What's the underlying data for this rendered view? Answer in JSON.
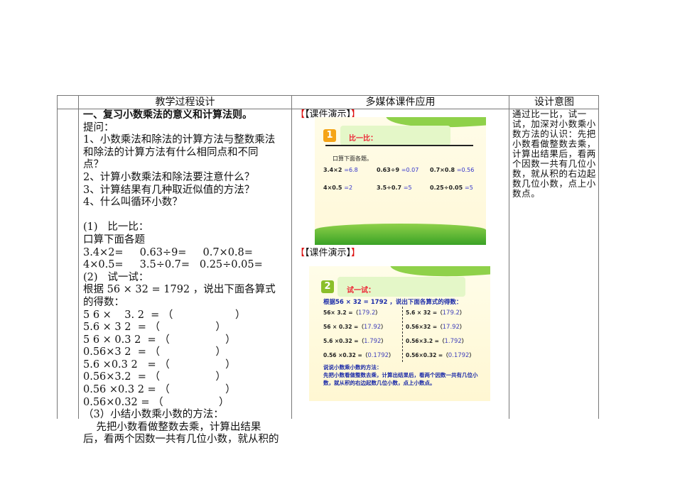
{
  "headers": [
    "教学过程设计",
    "多媒体课件应用",
    "设计意图"
  ],
  "left_lines": [
    {
      "t": "一、复习小数乘法的意义和计算法则。",
      "bold": true
    },
    {
      "t": "提问："
    },
    {
      "t": "1、小数乘法和除法的计算方法与整数乘法"
    },
    {
      "t": "和除法的计算方法有什么相同点和不同"
    },
    {
      "t": "点？"
    },
    {
      "t": "2、计算小数乘法和除法要注意什么？"
    },
    {
      "t": "3、计算结果有几种取近似值的方法？"
    },
    {
      "t": "4、什么叫循环小数？"
    },
    {
      "t": " "
    },
    {
      "t": "(1)   比一比："
    },
    {
      "t": "口算下面各题"
    },
    {
      "t": "3.4×2=     0.63÷9=     0.7×0.8="
    },
    {
      "t": "4×0.5=     3.5÷0.7=   0.25÷0.05="
    },
    {
      "t": "(2)   试一试："
    },
    {
      "t": "根据 56 × 32 = 1792 ，说出下面各算式"
    },
    {
      "t": "的得数："
    },
    {
      "t": "5 6 ×    3. 2  = （                   ）"
    },
    {
      "t": "5.6 × 3 2  = （                 ）"
    },
    {
      "t": "5 6 × 0.3 2  = （                 ）"
    },
    {
      "t": "0.56×3 2  = （                 ）"
    },
    {
      "t": "5.6 ×0.3 2   = （                 ）"
    },
    {
      "t": "0.56×3.2  = （                 ）"
    },
    {
      "t": "0.56 ×0.3 2 = （                 ）"
    },
    {
      "t": "0.56×0.32 = （                 ）"
    },
    {
      "t": "（3）小结小数乘小数的方法："
    },
    {
      "t": "    先把小数看做整数去乘，计算出结果"
    },
    {
      "t": "后，看两个因数一共有几位小数，就从积的"
    }
  ],
  "courseware_tag": "【课件演示】",
  "slide1": {
    "num": "1",
    "title": "比一比：",
    "subtitle": "口算下面各题。",
    "eqs": [
      [
        "3.4×2",
        "=6.8"
      ],
      [
        "0.63÷9",
        "=0.07"
      ],
      [
        "0.7×0.8",
        "=0.56"
      ],
      [
        "4×0.5",
        "=2"
      ],
      [
        "3.5÷0.7",
        "=5"
      ],
      [
        "0.25÷0.05",
        "=5"
      ]
    ]
  },
  "slide2": {
    "num": "2",
    "title": "试一试：",
    "prompt": "根据56 × 32 = 1792 ，说出下面各算式的得数：",
    "eqs": [
      [
        "56×  3.2 =（",
        "179.2",
        "）"
      ],
      [
        "5.6 × 32 =（",
        "179.2",
        "）"
      ],
      [
        "56 × 0.32 =（",
        "17.92",
        "）"
      ],
      [
        "0.56×32 =（",
        "17.92",
        "）"
      ],
      [
        "5.6 ×0.32  =（",
        "1.792",
        "）"
      ],
      [
        "0.56×3.2 =（",
        "1.792",
        "）"
      ],
      [
        "0.56 ×0.32 =（",
        "0.1792",
        "）"
      ],
      [
        "0.56×0.32 =（",
        "0.1792",
        "）"
      ]
    ],
    "method_title": "说说小数乘小数的方法：",
    "method_text": "先把小数看做整数去乘，计算出结果后，看两个因数一共有几位小数，就从积的右边起数几位小数，点上小数点。"
  },
  "intent": "通过比一比，试一试，加深对小数乘小数方法的认识：先把小数看做整数去乘，计算出结果后，看两个因数一共有几位小数，就从积的右边起数几位小数，点上小数点。",
  "colors": {
    "tag_bracket": "#dd1111",
    "answer_blue": "#3333cc"
  }
}
